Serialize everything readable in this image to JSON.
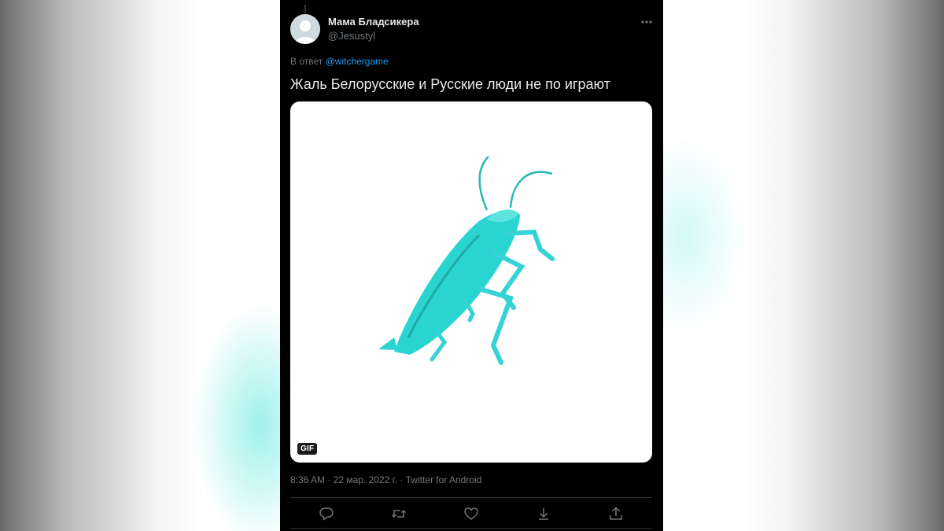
{
  "tweet": {
    "author": {
      "display_name": "Мама Бладсикера",
      "handle": "@Jesustyl"
    },
    "reply_prefix": "В ответ",
    "reply_mention": "@witchergame",
    "text": "Жаль Белорусские и Русские люди не по играют",
    "media": {
      "badge": "GIF",
      "subject_icon": "cockroach-gif"
    },
    "meta": {
      "time": "8:36 AM",
      "separator": " · ",
      "date": "22 мар. 2022 г.",
      "source": "Twitter for Android"
    },
    "actions": [
      {
        "icon": "reply-icon"
      },
      {
        "icon": "retweet-icon"
      },
      {
        "icon": "like-icon"
      },
      {
        "icon": "bookmark-icon"
      },
      {
        "icon": "share-icon"
      }
    ]
  },
  "colors": {
    "background": "#000000",
    "text_primary": "#e7e9ea",
    "text_secondary": "#71767b",
    "link": "#1d9bf0",
    "roach": "#2ad4d0"
  }
}
